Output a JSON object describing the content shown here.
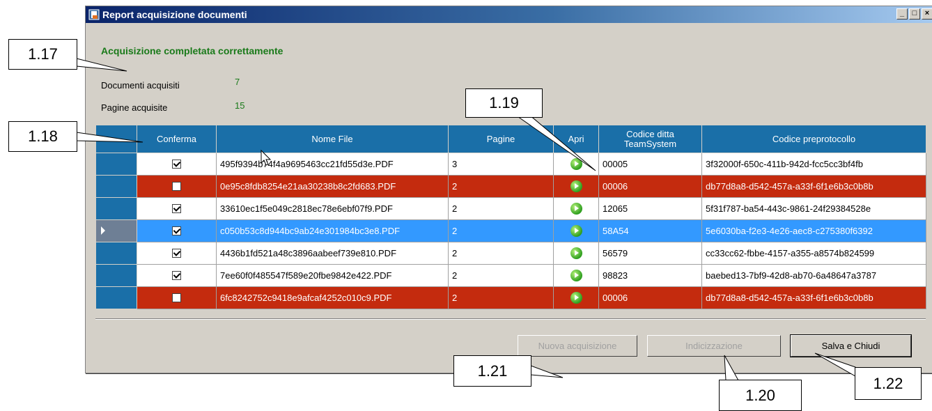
{
  "window": {
    "title": "Report acquisizione documenti",
    "controls": [
      "_",
      "□",
      "×"
    ]
  },
  "status": {
    "message": "Acquisizione completata correttamente",
    "docs_label": "Documenti acquisiti",
    "docs_value": "7",
    "pages_label": "Pagine acquisite",
    "pages_value": "15"
  },
  "grid": {
    "columns": {
      "confirm": "Conferma",
      "filename": "Nome File",
      "pages": "Pagine",
      "open": "Apri",
      "code_line1": "Codice ditta",
      "code_line2": "TeamSystem",
      "preprot": "Codice preprotocollo"
    },
    "rows": [
      {
        "confirmed": true,
        "filename": "495f9394b74f4a9695463cc21fd55d3e.PDF",
        "pages": "3",
        "code": "00005",
        "preprot": "3f32000f-650c-411b-942d-fcc5cc3bf4fb",
        "state": "normal"
      },
      {
        "confirmed": false,
        "filename": "0e95c8fdb8254e21aa30238b8c2fd683.PDF",
        "pages": "2",
        "code": "00006",
        "preprot": "db77d8a8-d542-457a-a33f-6f1e6b3c0b8b",
        "state": "error"
      },
      {
        "confirmed": true,
        "filename": "33610ec1f5e049c2818ec78e6ebf07f9.PDF",
        "pages": "2",
        "code": "12065",
        "preprot": "5f31f787-ba54-443c-9861-24f29384528e",
        "state": "normal"
      },
      {
        "confirmed": true,
        "filename": "c050b53c8d944bc9ab24e301984bc3e8.PDF",
        "pages": "2",
        "code": "58A54",
        "preprot": "5e6030ba-f2e3-4e26-aec8-c275380f6392",
        "state": "selected"
      },
      {
        "confirmed": true,
        "filename": "4436b1fd521a48c3896aabeef739e810.PDF",
        "pages": "2",
        "code": "56579",
        "preprot": "cc33cc62-fbbe-4157-a355-a8574b824599",
        "state": "normal"
      },
      {
        "confirmed": true,
        "filename": "7ee60f0f485547f589e20fbe9842e422.PDF",
        "pages": "2",
        "code": "98823",
        "preprot": "baebed13-7bf9-42d8-ab70-6a48647a3787",
        "state": "normal"
      },
      {
        "confirmed": false,
        "filename": "6fc8242752c9418e9afcaf4252c010c9.PDF",
        "pages": "2",
        "code": "00006",
        "preprot": "db77d8a8-d542-457a-a33f-6f1e6b3c0b8b",
        "state": "error"
      }
    ]
  },
  "buttons": {
    "new_acq": "Nuova acquisizione",
    "indexing": "Indicizzazione",
    "save_close": "Salva e Chiudi"
  },
  "callouts": {
    "c117": "1.17",
    "c118": "1.18",
    "c119": "1.19",
    "c120": "1.20",
    "c121": "1.21",
    "c122": "1.22"
  },
  "colors": {
    "header": "#1a6fa8",
    "error_row": "#c42b0e",
    "selected_row": "#3399ff",
    "status_text": "#1a7a1a"
  }
}
